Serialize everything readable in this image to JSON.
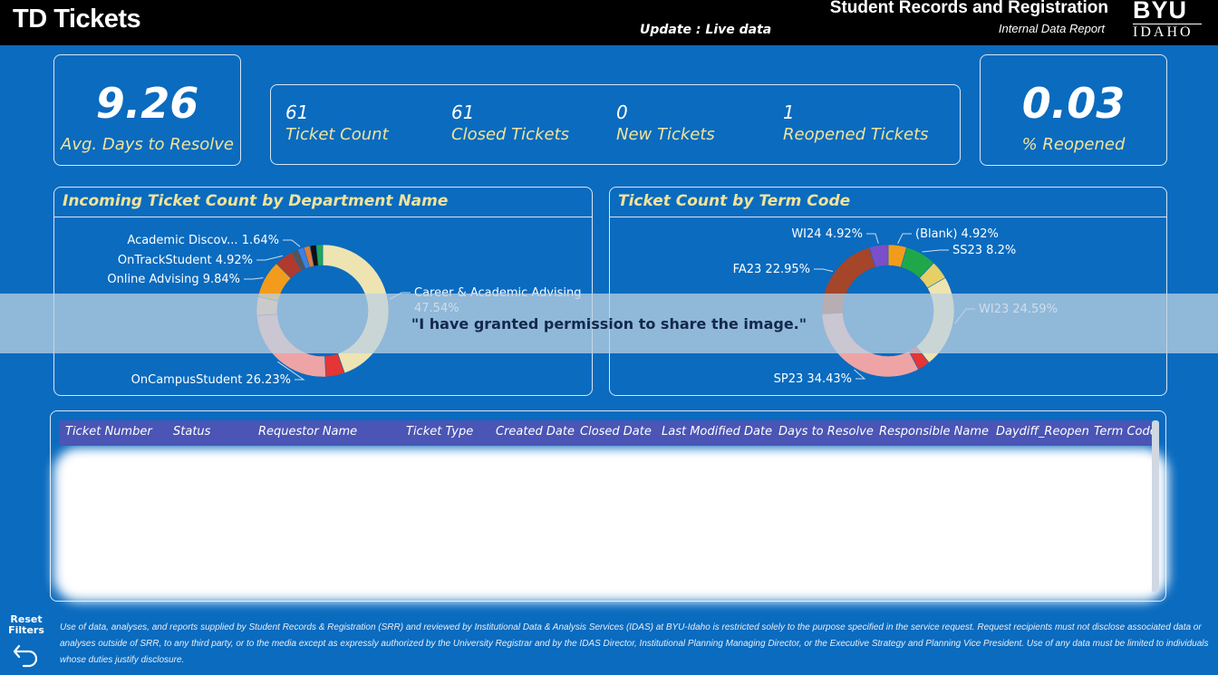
{
  "header": {
    "title": "TD Tickets",
    "update": "Update :  Live data",
    "org": "Student Records and Registration",
    "report": "Internal Data Report",
    "logo_top": "BYU",
    "logo_bottom": "IDAHO"
  },
  "kpi": {
    "avg_days": {
      "value": "9.26",
      "label": "Avg. Days to Resolve"
    },
    "pct_reopened": {
      "value": "0.03",
      "label": "% Reopened"
    },
    "counts": [
      {
        "value": "61",
        "label": "Ticket Count"
      },
      {
        "value": "61",
        "label": "Closed Tickets"
      },
      {
        "value": "0",
        "label": "New Tickets"
      },
      {
        "value": "1",
        "label": "Reopened Tickets"
      }
    ]
  },
  "chart_data": [
    {
      "type": "pie",
      "title": "Incoming Ticket Count by Department Name",
      "donut": true,
      "slices": [
        {
          "label": "Career & Academic Advising",
          "value": 47.54,
          "display": "Career & Academic Advising",
          "display2": "47.54%",
          "color": "#eee4b1"
        },
        {
          "label": "Unlabeled",
          "value": 4.92,
          "color": "#e53535"
        },
        {
          "label": "OnCampusStudent",
          "value": 26.23,
          "display": "OnCampusStudent 26.23%",
          "color": "#eea4a4"
        },
        {
          "label": "Unlabeled",
          "value": 4.92,
          "color": "#f0b383"
        },
        {
          "label": "Online Advising",
          "value": 9.84,
          "display": "Online Advising 9.84%",
          "color": "#f39c1c"
        },
        {
          "label": "OnTrackStudent",
          "value": 4.92,
          "display": "OnTrackStudent 4.92%",
          "color": "#b03a2e"
        },
        {
          "label": "Unlabeled",
          "value": 1.64,
          "color": "#555555"
        },
        {
          "label": "Academic Discov...",
          "value": 1.64,
          "display": "Academic Discov... 1.64%",
          "color": "#3f7fe0"
        },
        {
          "label": "Unlabeled",
          "value": 1.64,
          "color": "#e07b39"
        },
        {
          "label": "Unlabeled",
          "value": 1.64,
          "color": "#101010"
        },
        {
          "label": "Unlabeled",
          "value": 1.64,
          "color": "#1fa855"
        }
      ]
    },
    {
      "type": "pie",
      "title": "Ticket Count by Term Code",
      "donut": true,
      "slices": [
        {
          "label": "(Blank)",
          "value": 4.92,
          "display": "(Blank) 4.92%",
          "color": "#f39c1c"
        },
        {
          "label": "SS23",
          "value": 8.2,
          "display": "SS23 8.2%",
          "color": "#1fa84a"
        },
        {
          "label": "Unlabeled",
          "value": 4.92,
          "color": "#e6cf65"
        },
        {
          "label": "WI23",
          "value": 24.59,
          "display": "WI23 24.59%",
          "color": "#eee4b1"
        },
        {
          "label": "Unlabeled",
          "value": 3.28,
          "color": "#e53535"
        },
        {
          "label": "SP23",
          "value": 34.43,
          "display": "SP23 34.43%",
          "color": "#eea4a4"
        },
        {
          "label": "FA23",
          "value": 22.95,
          "display": "FA23 22.95%",
          "color": "#a5452a"
        },
        {
          "label": "WI24",
          "value": 4.92,
          "display": "WI24 4.92%",
          "color": "#7b4fc9"
        }
      ]
    }
  ],
  "table": {
    "columns": [
      "Ticket Number",
      "Status",
      "Requestor Name",
      "Ticket Type",
      "Created Date",
      "Closed Date",
      "Last Modified Date",
      "Days to Resolve",
      "Responsible Name",
      "Daydiff_Reopen",
      "Term Code"
    ]
  },
  "watermark": "\"I have granted permission to share the image.\"",
  "reset": {
    "line1": "Reset",
    "line2": "Filters"
  },
  "disclaimer": "Use of data, analyses, and reports supplied by Student Records & Registration (SRR) and reviewed by Institutional Data & Analysis Services (IDAS) at BYU-Idaho is restricted solely to the purpose specified in the service request. Request recipients must not disclose associated data or analyses outside of SRR, to any third party, or to the media except as expressly authorized by the University Registrar and by the IDAS Director, Institutional Planning Managing Director, or the Executive Strategy and Planning Vice President. Use of any data must be limited to individuals whose duties justify disclosure."
}
